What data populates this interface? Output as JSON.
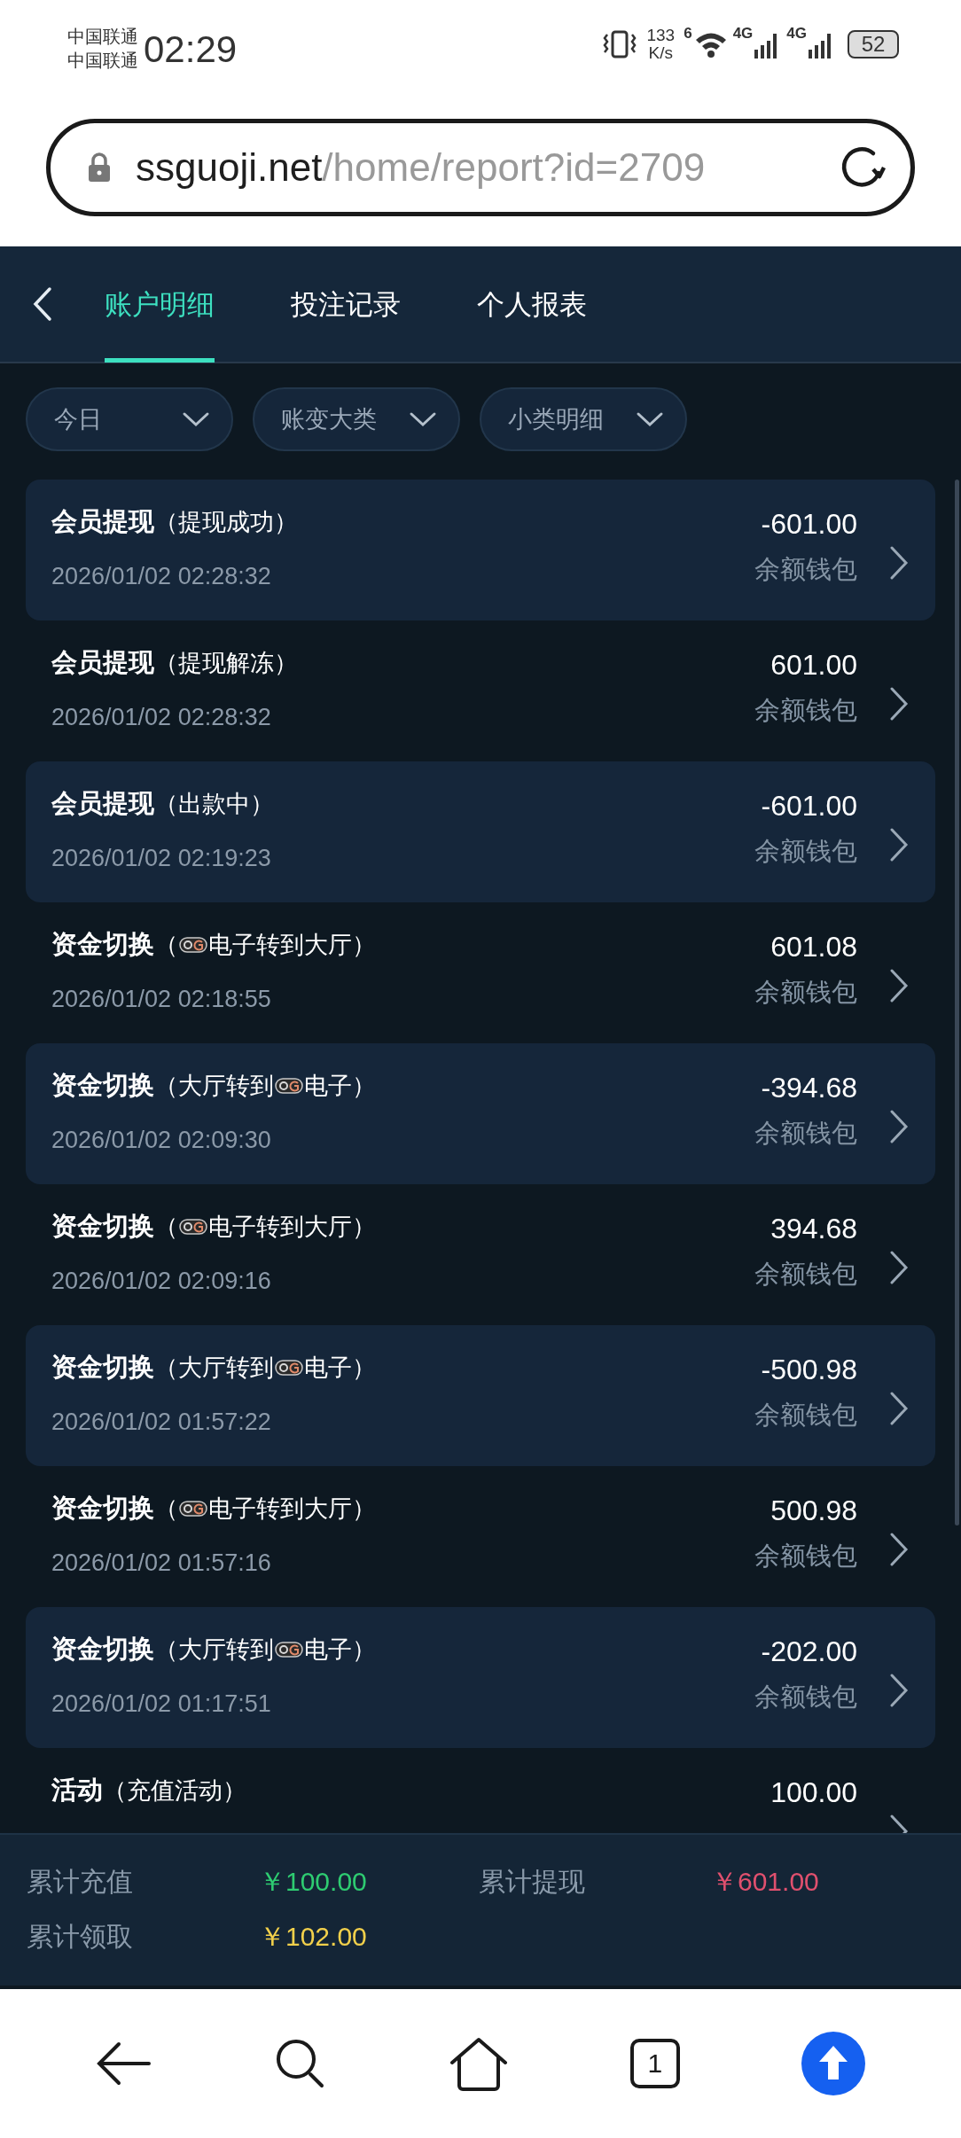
{
  "status_bar": {
    "carriers": [
      "中国联通",
      "中国联通"
    ],
    "time": "02:29",
    "speed_value": "133",
    "speed_unit": "K/s",
    "wifi_label": "6",
    "networks": [
      "4G",
      "4G"
    ],
    "battery": "52"
  },
  "address_bar": {
    "domain": "ssguoji.net",
    "path": "/home/report?id=2709"
  },
  "tabs": [
    {
      "label": "账户明细",
      "selected": true
    },
    {
      "label": "投注记录",
      "selected": false
    },
    {
      "label": "个人报表",
      "selected": false
    }
  ],
  "filters": [
    "今日",
    "账变大类",
    "小类明细"
  ],
  "rows": [
    {
      "title": "会员提现",
      "detail": [
        {
          "kind": "text",
          "text": "（提现成功）"
        }
      ],
      "time": "2026/01/02 02:28:32",
      "amount": "-601.00",
      "wallet": "余额钱包"
    },
    {
      "title": "会员提现",
      "detail": [
        {
          "kind": "text",
          "text": "（提现解冻）"
        }
      ],
      "time": "2026/01/02 02:28:32",
      "amount": "601.00",
      "wallet": "余额钱包"
    },
    {
      "title": "会员提现",
      "detail": [
        {
          "kind": "text",
          "text": "（出款中）"
        }
      ],
      "time": "2026/01/02 02:19:23",
      "amount": "-601.00",
      "wallet": "余额钱包"
    },
    {
      "title": "资金切换",
      "detail": [
        {
          "kind": "text",
          "text": "（"
        },
        {
          "kind": "logo"
        },
        {
          "kind": "text",
          "text": "电子转到大厅）"
        }
      ],
      "time": "2026/01/02 02:18:55",
      "amount": "601.08",
      "wallet": "余额钱包"
    },
    {
      "title": "资金切换",
      "detail": [
        {
          "kind": "text",
          "text": "（大厅转到"
        },
        {
          "kind": "logo"
        },
        {
          "kind": "text",
          "text": "电子）"
        }
      ],
      "time": "2026/01/02 02:09:30",
      "amount": "-394.68",
      "wallet": "余额钱包"
    },
    {
      "title": "资金切换",
      "detail": [
        {
          "kind": "text",
          "text": "（"
        },
        {
          "kind": "logo"
        },
        {
          "kind": "text",
          "text": "电子转到大厅）"
        }
      ],
      "time": "2026/01/02 02:09:16",
      "amount": "394.68",
      "wallet": "余额钱包"
    },
    {
      "title": "资金切换",
      "detail": [
        {
          "kind": "text",
          "text": "（大厅转到"
        },
        {
          "kind": "logo"
        },
        {
          "kind": "text",
          "text": "电子）"
        }
      ],
      "time": "2026/01/02 01:57:22",
      "amount": "-500.98",
      "wallet": "余额钱包"
    },
    {
      "title": "资金切换",
      "detail": [
        {
          "kind": "text",
          "text": "（"
        },
        {
          "kind": "logo"
        },
        {
          "kind": "text",
          "text": "电子转到大厅）"
        }
      ],
      "time": "2026/01/02 01:57:16",
      "amount": "500.98",
      "wallet": "余额钱包"
    },
    {
      "title": "资金切换",
      "detail": [
        {
          "kind": "text",
          "text": "（大厅转到"
        },
        {
          "kind": "logo"
        },
        {
          "kind": "text",
          "text": "电子）"
        }
      ],
      "time": "2026/01/02 01:17:51",
      "amount": "-202.00",
      "wallet": "余额钱包"
    },
    {
      "title": "活动",
      "detail": [
        {
          "kind": "text",
          "text": "（充值活动）"
        }
      ],
      "amount": "100.00"
    }
  ],
  "summary": [
    {
      "label": "累计充值",
      "value": "￥100.00",
      "color": "#2ecc71"
    },
    {
      "label": "累计提现",
      "value": "￥601.00",
      "color": "#e0506e"
    },
    {
      "label": "累计领取",
      "value": "￥102.00",
      "color": "#f2d04b"
    }
  ],
  "bottom_nav": {
    "tab_count": "1"
  }
}
